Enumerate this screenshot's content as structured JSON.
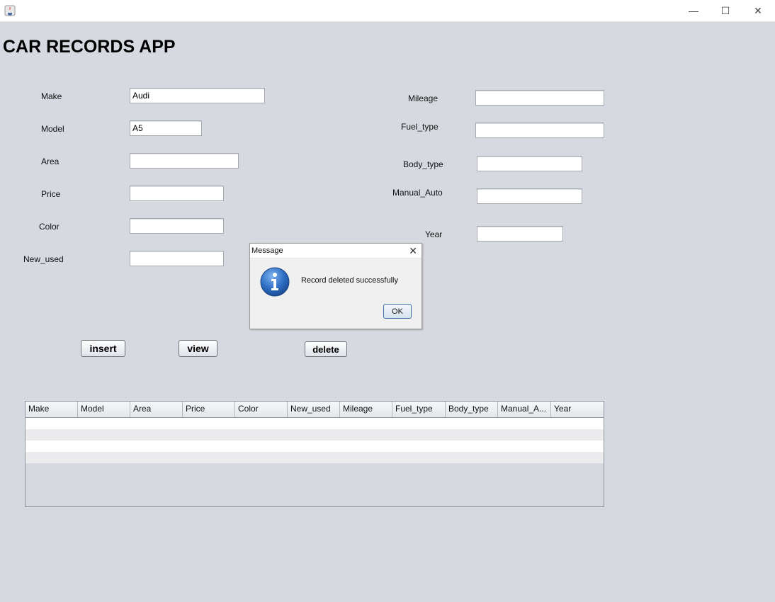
{
  "window": {
    "minimize": "—",
    "maximize": "☐",
    "close": "✕"
  },
  "app_title": "CAR RECORDS APP",
  "labels": {
    "make": "Make",
    "model": "Model",
    "area": "Area",
    "price": "Price",
    "color": "Color",
    "new_used": "New_used",
    "mileage": "Mileage",
    "fuel_type": "Fuel_type",
    "body_type": "Body_type",
    "manual_auto": "Manual_Auto",
    "year": "Year"
  },
  "fields": {
    "make": "Audi",
    "model": "A5",
    "area": "",
    "price": "",
    "color": "",
    "new_used": "",
    "mileage": "",
    "fuel_type": "",
    "body_type": "",
    "manual_auto": "",
    "year": ""
  },
  "buttons": {
    "insert": "insert",
    "view": "view",
    "delete": "delete"
  },
  "table": {
    "columns": [
      "Make",
      "Model",
      "Area",
      "Price",
      "Color",
      "New_used",
      "Mileage",
      "Fuel_type",
      "Body_type",
      "Manual_A...",
      "Year"
    ]
  },
  "dialog": {
    "title": "Message",
    "message": "Record deleted successfully",
    "ok": "OK",
    "close": "✕"
  }
}
